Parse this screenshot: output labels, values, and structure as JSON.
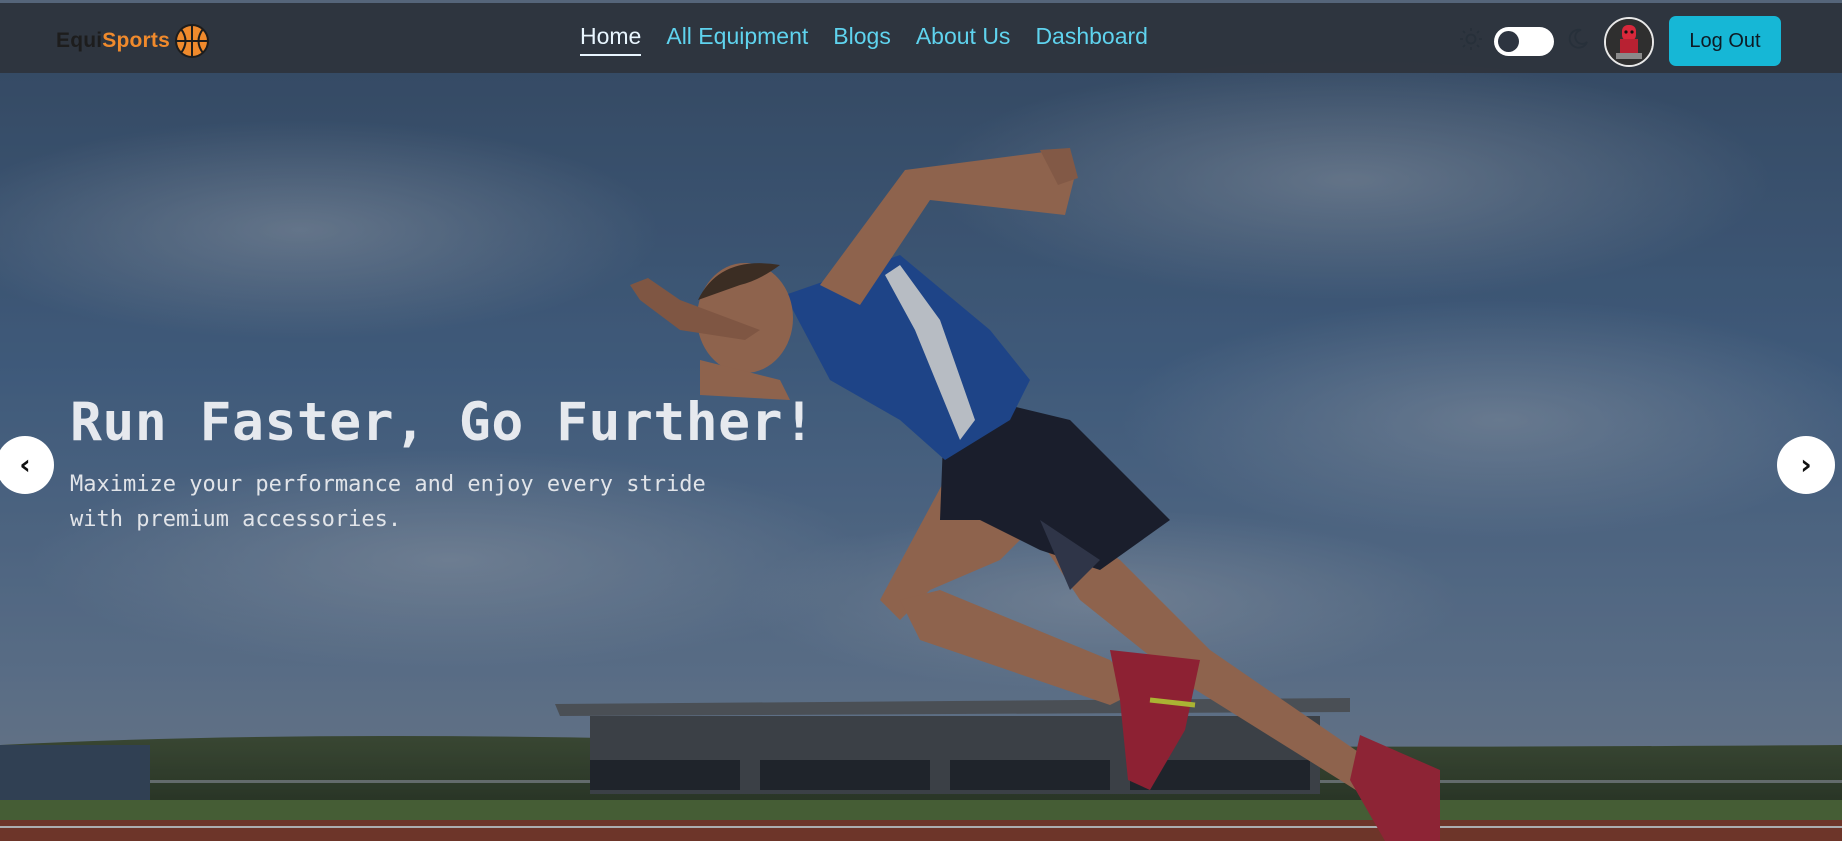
{
  "brand": {
    "name_part1": "Equi",
    "name_part2": "Sports",
    "accent_color": "#f08a2c",
    "logo_icon": "basketball-icon"
  },
  "nav": {
    "items": [
      {
        "label": "Home",
        "active": true
      },
      {
        "label": "All Equipment",
        "active": false
      },
      {
        "label": "Blogs",
        "active": false
      },
      {
        "label": "About Us",
        "active": false
      },
      {
        "label": "Dashboard",
        "active": false
      }
    ],
    "link_color": "#5fd3ee"
  },
  "theme_toggle": {
    "left_icon": "sun-icon",
    "right_icon": "moon-icon",
    "state": "light"
  },
  "user": {
    "avatar_icon": "user-avatar",
    "logout_label": "Log Out",
    "logout_color": "#16b7d6"
  },
  "hero": {
    "title": "Run Faster, Go Further!",
    "subtitle": "Maximize your performance and enjoy every stride with premium accessories.",
    "prev_label": "‹",
    "next_label": "›",
    "image_subject": "sprinter-starting-blocks-photo"
  }
}
